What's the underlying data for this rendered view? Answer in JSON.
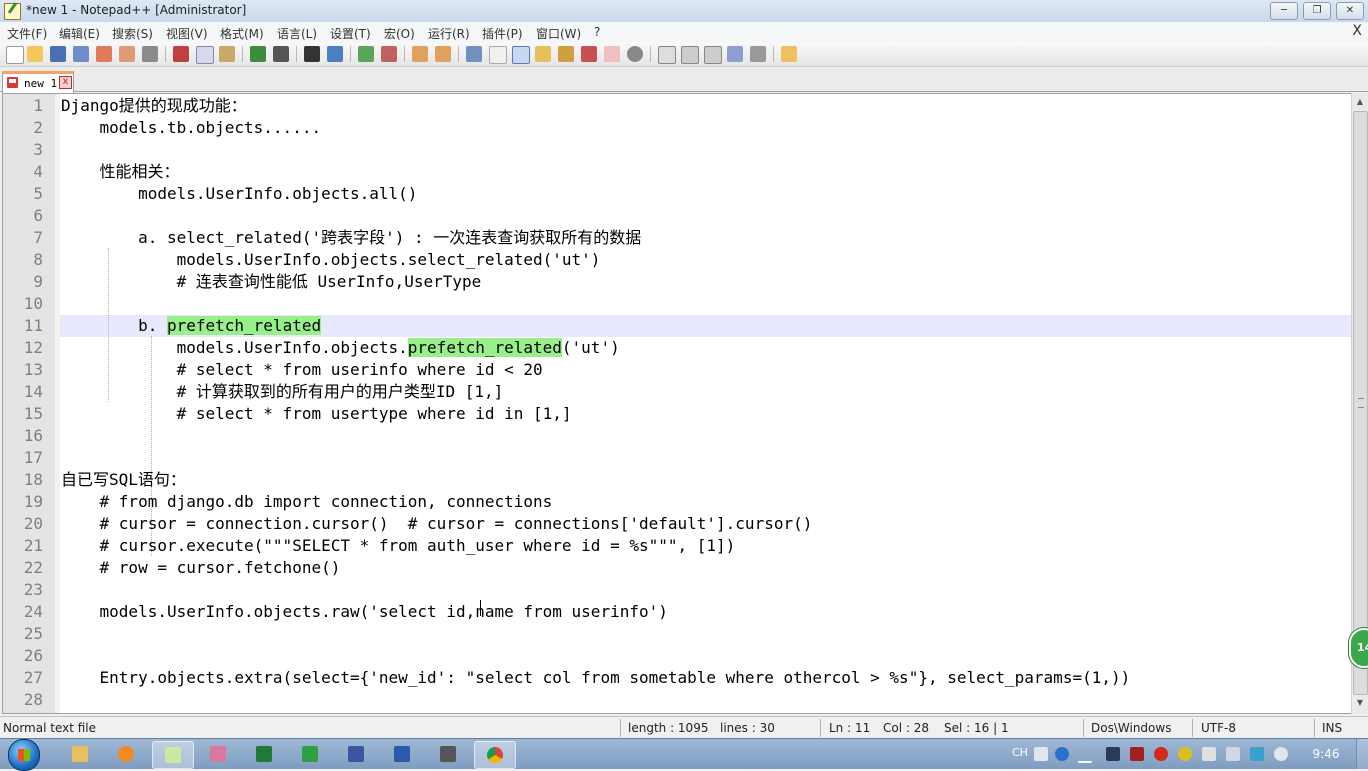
{
  "window": {
    "title": "*new 1 - Notepad++ [Administrator]",
    "controls": [
      "minimize",
      "restore",
      "close"
    ]
  },
  "menu": {
    "items": [
      "文件(F)",
      "编辑(E)",
      "搜索(S)",
      "视图(V)",
      "格式(M)",
      "语言(L)",
      "设置(T)",
      "宏(O)",
      "运行(R)",
      "插件(P)",
      "窗口(W)",
      "?"
    ],
    "close_doc": "X"
  },
  "tabs": [
    {
      "label": "new 1",
      "modified": true,
      "close": "x"
    }
  ],
  "editor": {
    "current_line": 11,
    "lines": [
      {
        "n": "1",
        "text": "Django提供的现成功能："
      },
      {
        "n": "2",
        "text": "    models.tb.objects......"
      },
      {
        "n": "3",
        "text": ""
      },
      {
        "n": "4",
        "text": "    性能相关："
      },
      {
        "n": "5",
        "text": "        models.UserInfo.objects.all()"
      },
      {
        "n": "6",
        "text": ""
      },
      {
        "n": "7",
        "text": "        a. select_related('跨表字段') : 一次连表查询获取所有的数据"
      },
      {
        "n": "8",
        "text": "            models.UserInfo.objects.select_related('ut')"
      },
      {
        "n": "9",
        "text": "            # 连表查询性能低 UserInfo,UserType"
      },
      {
        "n": "10",
        "text": ""
      },
      {
        "n": "11",
        "prefix": "        b. ",
        "highlight": "prefetch_related",
        "suffix": ""
      },
      {
        "n": "12",
        "prefix": "            models.UserInfo.objects.",
        "highlight": "prefetch_related",
        "suffix": "('ut')"
      },
      {
        "n": "13",
        "text": "            # select * from userinfo where id < 20"
      },
      {
        "n": "14",
        "text": "            # 计算获取到的所有用户的用户类型ID [1,]"
      },
      {
        "n": "15",
        "text": "            # select * from usertype where id in [1,]"
      },
      {
        "n": "16",
        "text": ""
      },
      {
        "n": "17",
        "text": ""
      },
      {
        "n": "18",
        "text": "自已写SQL语句："
      },
      {
        "n": "19",
        "text": "    # from django.db import connection, connections"
      },
      {
        "n": "20",
        "text": "    # cursor = connection.cursor()  # cursor = connections['default'].cursor()"
      },
      {
        "n": "21",
        "text": "    # cursor.execute(\"\"\"SELECT * from auth_user where id = %s\"\"\", [1])"
      },
      {
        "n": "22",
        "text": "    # row = cursor.fetchone()"
      },
      {
        "n": "23",
        "text": ""
      },
      {
        "n": "24",
        "text": "    models.UserInfo.objects.raw('select id,name from userinfo')"
      },
      {
        "n": "25",
        "text": ""
      },
      {
        "n": "26",
        "text": ""
      },
      {
        "n": "27",
        "text": "    Entry.objects.extra(select={'new_id': \"select col from sometable where othercol > %s\"}, select_params=(1,))"
      },
      {
        "n": "28",
        "text": ""
      }
    ]
  },
  "statusbar": {
    "file_type": "Normal text file",
    "length": "length : 1095",
    "lines": "lines : 30",
    "ln": "Ln : 11",
    "col": "Col : 28",
    "sel": "Sel : 16 | 1",
    "eol": "Dos\\Windows",
    "encoding": "UTF-8",
    "mode": "INS"
  },
  "badge": {
    "value": "14"
  },
  "taskbar": {
    "apps": [
      "explorer-icon",
      "firefox-icon",
      "notepadpp-icon",
      "paint-icon",
      "excel-icon",
      "pycharm-icon",
      "save-icon",
      "word-icon",
      "tools-icon",
      "chrome-icon"
    ],
    "tray": {
      "lang": "CH",
      "clock": "9:46"
    }
  },
  "colors": {
    "highlight": "#99f08a",
    "current_line": "#e8e8ff",
    "line_number": "#808080",
    "tab_accent": "#f4a460"
  }
}
